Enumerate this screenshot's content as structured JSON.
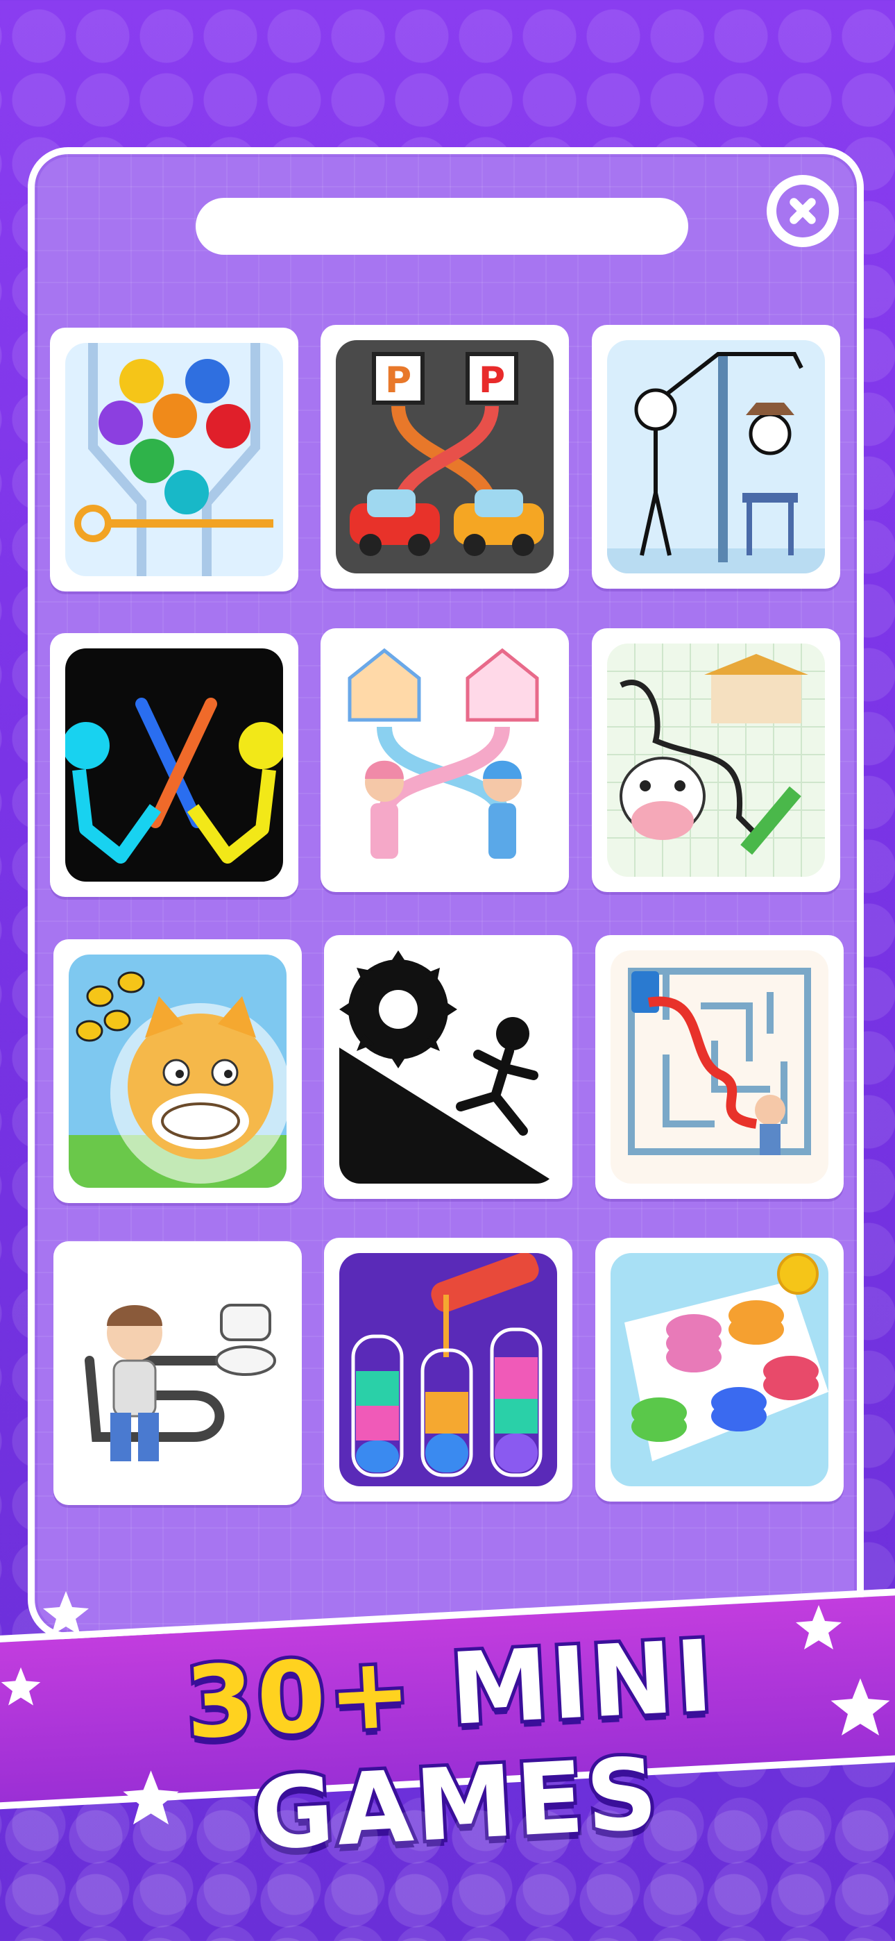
{
  "search": {
    "value": ""
  },
  "close": {
    "icon": "close-icon"
  },
  "games": [
    {
      "name": "pin-pull-balls-game-icon"
    },
    {
      "name": "parking-cars-game-icon"
    },
    {
      "name": "stickman-puzzle-game-icon"
    },
    {
      "name": "stickman-sword-fight-game-icon"
    },
    {
      "name": "love-path-houses-game-icon"
    },
    {
      "name": "draw-path-cow-game-icon"
    },
    {
      "name": "doge-bees-game-icon"
    },
    {
      "name": "saw-escape-game-icon"
    },
    {
      "name": "toilet-maze-game-icon"
    },
    {
      "name": "toilet-rush-draw-game-icon"
    },
    {
      "name": "water-sort-game-icon"
    },
    {
      "name": "coin-sort-game-icon"
    }
  ],
  "banner": {
    "accent_text": "30+",
    "text": "MINI GAMES"
  },
  "colors": {
    "background": "#7a34e6",
    "panel": "#a775f1",
    "banner": "#b534db",
    "accent": "#ffd21f"
  }
}
